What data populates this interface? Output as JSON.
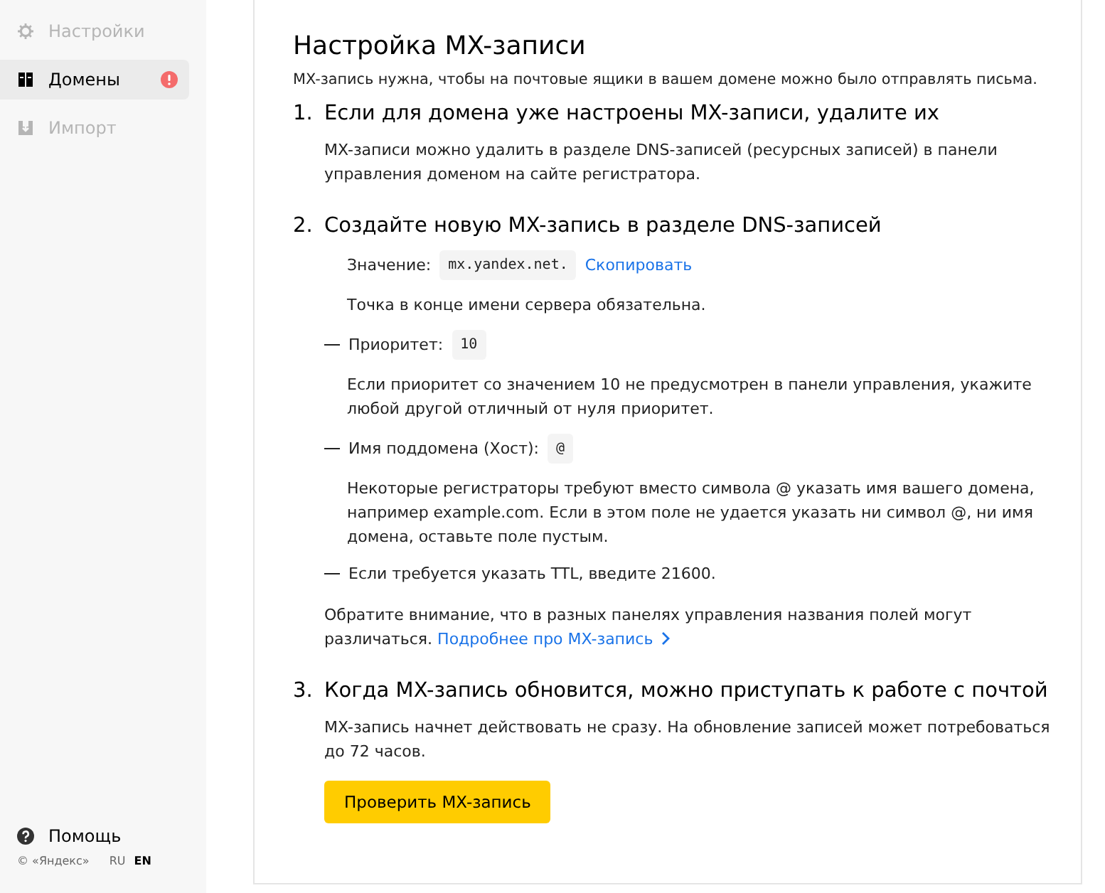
{
  "sidebar": {
    "items": [
      {
        "label": "Настройки",
        "selected": false,
        "disabled": true,
        "alert": false
      },
      {
        "label": "Домены",
        "selected": true,
        "disabled": false,
        "alert": true
      },
      {
        "label": "Импорт",
        "selected": false,
        "disabled": true,
        "alert": false
      }
    ],
    "help": "Помощь",
    "copyright": "© «Яндекс»",
    "languages": [
      {
        "label": "RU",
        "selected": false
      },
      {
        "label": "EN",
        "selected": true
      }
    ]
  },
  "main": {
    "title": "Настройка MX-записи",
    "subtitle": "MX-запись нужна, чтобы на почтовые ящики в вашем домене можно было отправлять письма.",
    "steps": [
      {
        "number": "1.",
        "title": "Если для домена уже настроены MX-записи, удалите их",
        "content": [
          {
            "kind": "text",
            "text": "MX-записи можно удалить в разделе DNS-записей (ресурсных записей) в панели управления доменом на сайте регистратора."
          }
        ]
      },
      {
        "number": "2.",
        "title": "Создайте новую MX-запись в разделе DNS-записей",
        "content": [
          {
            "kind": "field",
            "label": "Значение:",
            "value": "mx.yandex.net.",
            "link": "Скопировать"
          },
          {
            "kind": "note",
            "text": "Точка в конце имени сервера обязательна."
          },
          {
            "kind": "dash-field",
            "label": "Приоритет:",
            "value": "10"
          },
          {
            "kind": "note",
            "text": "Если приоритет со значением 10 не предусмотрен в панели управления, укажите любой другой отличный от нуля приоритет."
          },
          {
            "kind": "dash-field",
            "label": "Имя поддомена (Хост):",
            "value": "@"
          },
          {
            "kind": "note",
            "text": "Некоторые регистраторы требуют вместо символа @ указать имя вашего домена, например example.com. Если в этом поле не удается указать ни символ @, ни имя домена, оставьте поле пустым."
          },
          {
            "kind": "dash-text",
            "text": "Если требуется указать TTL, введите 21600."
          },
          {
            "kind": "remark",
            "text": "Обратите внимание, что в разных панелях управления названия полей могут различаться.",
            "link": "Подробнее про MX-запись"
          }
        ]
      },
      {
        "number": "3.",
        "title": "Когда MX-запись обновится, можно приступать к работе с почтой",
        "content": [
          {
            "kind": "text",
            "text": "MX-запись начнет действовать не сразу. На обновление записей может потребоваться до 72 часов."
          },
          {
            "kind": "button",
            "label": "Проверить MX-запись"
          }
        ]
      }
    ]
  }
}
